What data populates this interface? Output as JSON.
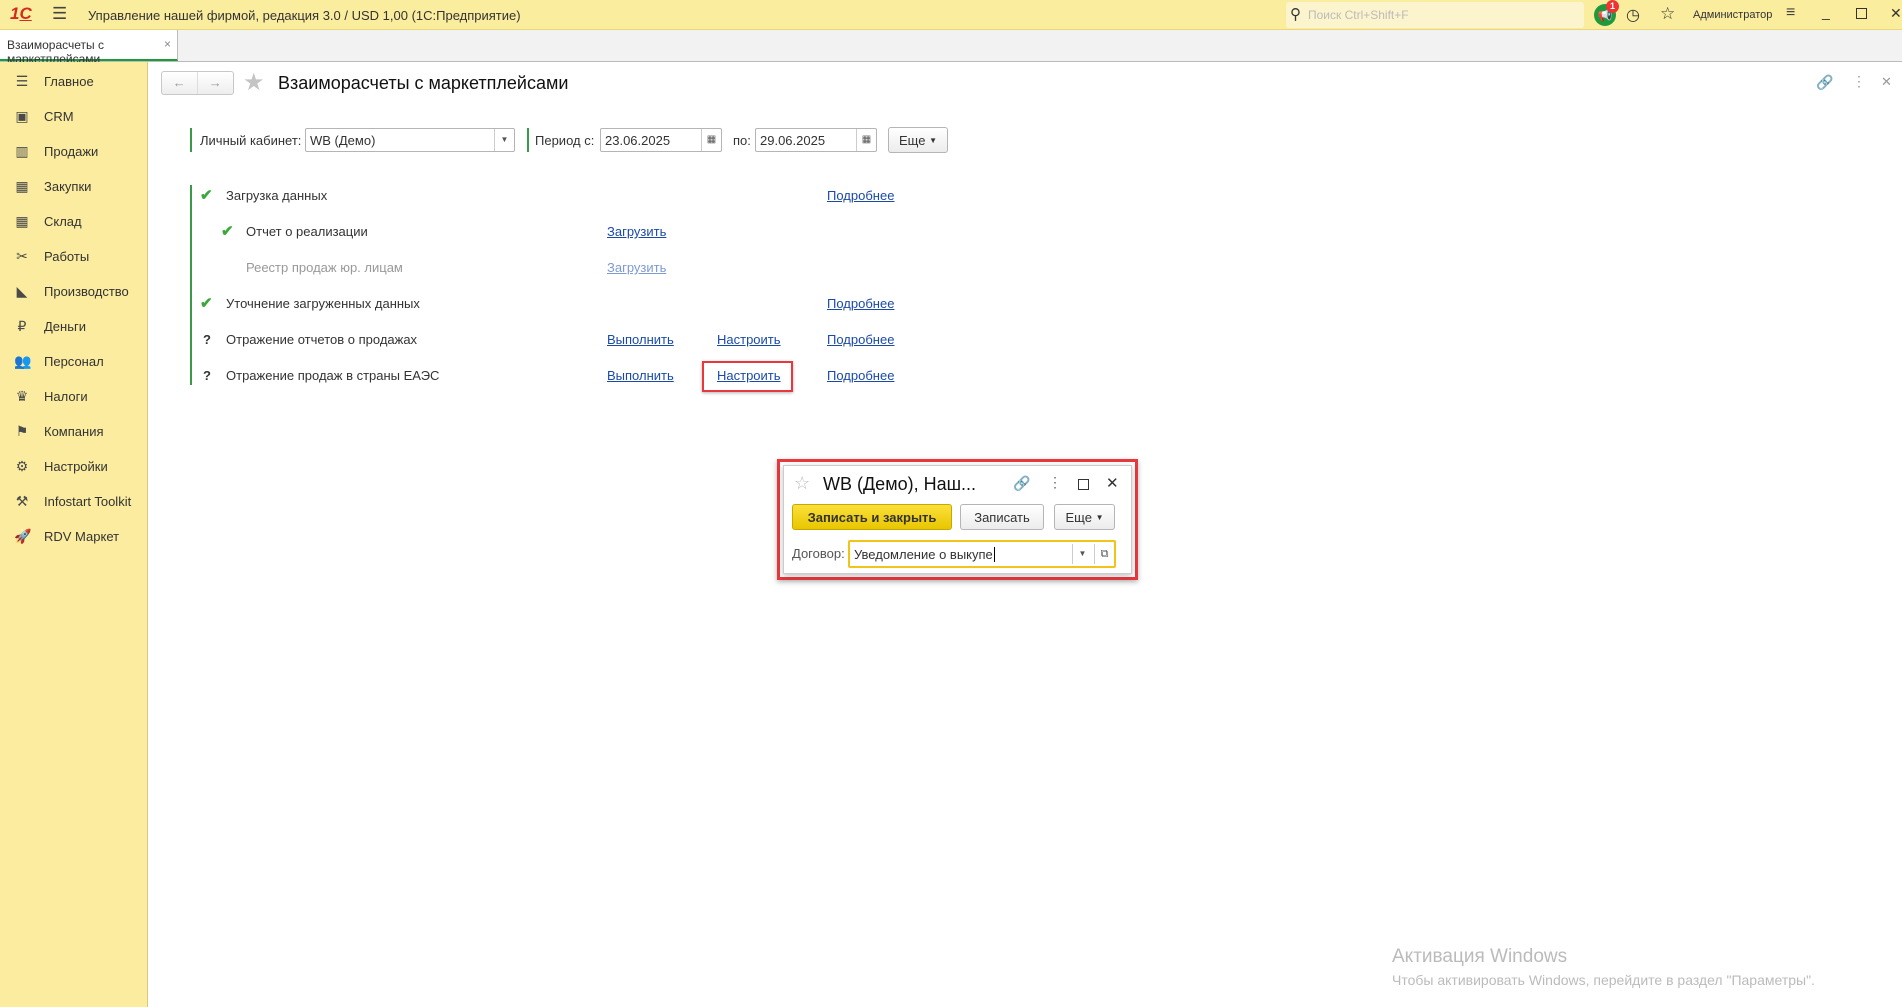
{
  "titlebar": {
    "title": "Управление нашей фирмой, редакция 3.0 / USD 1,00  (1С:Предприятие)",
    "search_placeholder": "Поиск Ctrl+Shift+F",
    "notification_count": "1",
    "user": "Администратор"
  },
  "tabs": [
    {
      "label": "Взаиморасчеты с маркетплейсами",
      "close": "×"
    }
  ],
  "sidebar": {
    "items": [
      {
        "label": "Главное"
      },
      {
        "label": "CRM"
      },
      {
        "label": "Продажи"
      },
      {
        "label": "Закупки"
      },
      {
        "label": "Склад"
      },
      {
        "label": "Работы"
      },
      {
        "label": "Производство"
      },
      {
        "label": "Деньги"
      },
      {
        "label": "Персонал"
      },
      {
        "label": "Налоги"
      },
      {
        "label": "Компания"
      },
      {
        "label": "Настройки"
      },
      {
        "label": "Infostart Toolkit"
      },
      {
        "label": "RDV Маркет"
      }
    ]
  },
  "page": {
    "title": "Взаиморасчеты с маркетплейсами",
    "filters": {
      "cabinet_label": "Личный кабинет:",
      "cabinet_value": "WB (Демо)",
      "period_from_label": "Период с:",
      "period_from": "23.06.2025",
      "period_to_label": "по:",
      "period_to": "29.06.2025",
      "more_label": "Еще"
    },
    "steps": [
      {
        "status": "✔",
        "label": "Загрузка данных",
        "details": "Подробнее"
      },
      {
        "status": "✔",
        "label": "Отчет о реализации",
        "load": "Загрузить"
      },
      {
        "label": "Реестр продаж юр. лицам",
        "load": "Загрузить"
      },
      {
        "status": "✔",
        "label": "Уточнение загруженных данных",
        "details": "Подробнее"
      },
      {
        "status": "?",
        "label": "Отражение отчетов о продажах",
        "run": "Выполнить",
        "setup": "Настроить",
        "details": "Подробнее"
      },
      {
        "status": "?",
        "label": "Отражение продаж в страны ЕАЭС",
        "run": "Выполнить",
        "setup": "Настроить",
        "details": "Подробнее"
      }
    ]
  },
  "dialog": {
    "title": "WB (Демо), Наш...",
    "save_close": "Записать и закрыть",
    "save": "Записать",
    "more": "Еще",
    "contract_label": "Договор:",
    "contract_value": "Уведомление о выкупе"
  },
  "watermark": {
    "line1": "Активация Windows",
    "line2": "Чтобы активировать Windows, перейдите в раздел \"Параметры\"."
  },
  "colors": {
    "accent_yellow": "#f5d90f",
    "highlight_red": "#e8383d",
    "green": "#3aa83a",
    "link": "#1a4aa8"
  }
}
